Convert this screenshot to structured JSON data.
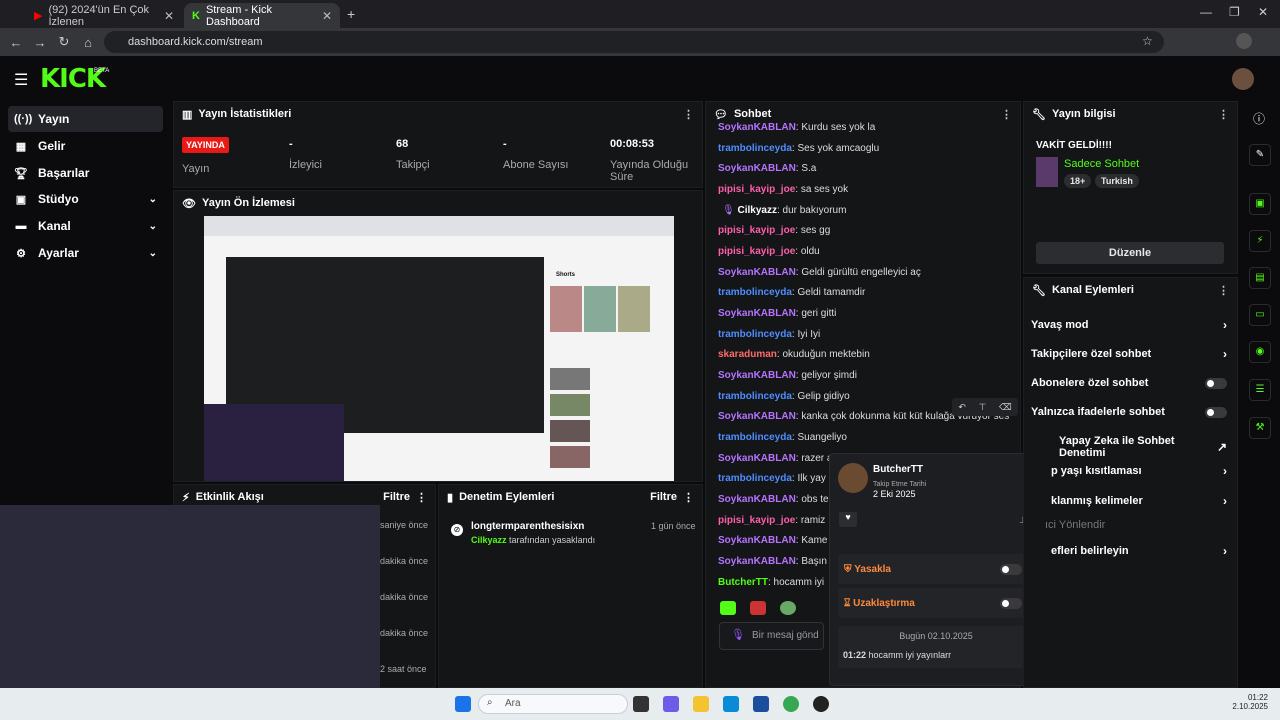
{
  "browser": {
    "tabs": [
      {
        "title": "(92) 2024'ün En Çok İzlenen"
      },
      {
        "title": "Stream - Kick Dashboard"
      }
    ],
    "url": "dashboard.kick.com/stream"
  },
  "kick": {
    "logo": "KICK",
    "beta": "BETA"
  },
  "nav": [
    {
      "label": "Yayın",
      "icon": "broadcast-icon"
    },
    {
      "label": "Gelir",
      "icon": "revenue-icon"
    },
    {
      "label": "Başarılar",
      "icon": "trophy-icon"
    },
    {
      "label": "Stüdyo",
      "icon": "studio-icon"
    },
    {
      "label": "Kanal",
      "icon": "channel-icon"
    },
    {
      "label": "Ayarlar",
      "icon": "gear-icon"
    }
  ],
  "stats": {
    "title": "Yayın İstatistikleri",
    "live_badge": "YAYINDA",
    "items": [
      {
        "value": "",
        "label": "Yayın"
      },
      {
        "value": "-",
        "label": "İzleyici"
      },
      {
        "value": "68",
        "label": "Takipçi"
      },
      {
        "value": "-",
        "label": "Abone Sayısı"
      },
      {
        "value": "00:08:53",
        "label": "Yayında Olduğu Süre"
      }
    ]
  },
  "preview": {
    "title": "Yayın Ön İzlemesi",
    "shorts_label": "Shorts"
  },
  "activity": {
    "title": "Etkinlik Akışı",
    "filter": "Filtre",
    "times": [
      "saniye önce",
      "dakika önce",
      "dakika önce",
      "dakika önce",
      "dakika önce",
      "2 saat önce"
    ]
  },
  "moderation": {
    "title": "Denetim Eylemleri",
    "filter": "Filtre",
    "entry": {
      "user": "longtermparenthesisixn",
      "time": "1 gün önce",
      "by": "Cilkyazz",
      "action": "tarafından yasaklandı"
    }
  },
  "chat": {
    "title": "Sohbet",
    "placeholder": "Bir mesaj gönd",
    "messages": [
      {
        "user": "SoykanKABLAN",
        "text": ": Kurdu ses yok la",
        "color": "#b573ff"
      },
      {
        "user": "trambolinceyda",
        "text": ": Ses yok amcaoglu",
        "color": "#4f8dff"
      },
      {
        "user": "SoykanKABLAN",
        "text": ": S.a",
        "color": "#b573ff"
      },
      {
        "user": "pipisi_kayip_joe",
        "text": ": sa ses yok",
        "color": "#ff5fae"
      },
      {
        "user": "Cilkyazz",
        "text": ": dur bakıyorum",
        "color": "#ffffff"
      },
      {
        "user": "pipisi_kayip_joe",
        "text": ": ses gg",
        "color": "#ff5fae"
      },
      {
        "user": "pipisi_kayip_joe",
        "text": ": oldu",
        "color": "#ff5fae"
      },
      {
        "user": "SoykanKABLAN",
        "text": ": Geldi gürültü engelleyici aç",
        "color": "#b573ff"
      },
      {
        "user": "trambolinceyda",
        "text": ": Geldi tamamdir",
        "color": "#4f8dff"
      },
      {
        "user": "SoykanKABLAN",
        "text": ": geri gitti",
        "color": "#b573ff"
      },
      {
        "user": "trambolinceyda",
        "text": ": Iyi Iyi",
        "color": "#4f8dff"
      },
      {
        "user": "skaraduman",
        "text": ": okuduğun mektebin",
        "color": "#ff6b6b"
      },
      {
        "user": "SoykanKABLAN",
        "text": ": geliyor şimdi",
        "color": "#b573ff"
      },
      {
        "user": "trambolinceyda",
        "text": ": Gelip gidiyo",
        "color": "#4f8dff"
      },
      {
        "user": "SoykanKABLAN",
        "text": ": kanka çok dokunma küt küt kulağa vuruyor ses",
        "color": "#b573ff"
      },
      {
        "user": "trambolinceyda",
        "text": ": Suangeliyo",
        "color": "#4f8dff"
      },
      {
        "user": "SoykanKABLAN",
        "text": ": razer a",
        "color": "#b573ff"
      },
      {
        "user": "trambolinceyda",
        "text": ": Ilk yay",
        "color": "#4f8dff"
      },
      {
        "user": "SoykanKABLAN",
        "text": ": obs te",
        "color": "#b573ff"
      },
      {
        "user": "pipisi_kayip_joe",
        "text": ": ramiz",
        "color": "#ff5fae"
      },
      {
        "user": "SoykanKABLAN",
        "text": ": Kame",
        "color": "#b573ff"
      },
      {
        "user": "SoykanKABLAN",
        "text": ": Başın",
        "color": "#b573ff"
      },
      {
        "user": "ButcherTT",
        "text": ": hocamm iyi",
        "color": "#53fc18"
      }
    ]
  },
  "usercard": {
    "name": "ButcherTT",
    "follow_label": "Takip Etme Tarihi",
    "follow_date": "2 Eki 2025",
    "ban": "Yasakla",
    "timeout": "Uzaklaştırma",
    "today": "Bugün 02.10.2025",
    "msg_time": "01:22",
    "msg_text": "hocamm iyi yayınlarr"
  },
  "streaminfo": {
    "title": "Yayın bilgisi",
    "stream_title": "VAKİT GELDİ!!!!",
    "category": "Sadece Sohbet",
    "tags": [
      "18+",
      "Turkish"
    ],
    "edit": "Düzenle"
  },
  "channelactions": {
    "title": "Kanal Eylemleri",
    "items": [
      {
        "label": "Yavaş mod",
        "type": "arrow"
      },
      {
        "label": "Takipçilere özel sohbet",
        "type": "arrow"
      },
      {
        "label": "Abonelere özel sohbet",
        "type": "toggle"
      },
      {
        "label": "Yalnızca ifadelerle sohbet",
        "type": "toggle"
      },
      {
        "label": "Yapay Zeka ile Sohbet Denetimi",
        "type": "external"
      },
      {
        "label": "p yaşı kısıtlaması",
        "type": "arrow"
      },
      {
        "label": "klanmış kelimeler",
        "type": "arrow"
      },
      {
        "label": "ıci Yönlendir",
        "type": "none"
      },
      {
        "label": "efleri belirleyin",
        "type": "arrow"
      }
    ]
  },
  "taskbar": {
    "search": "Ara",
    "time": "01:22",
    "date": "2.10.2025"
  }
}
